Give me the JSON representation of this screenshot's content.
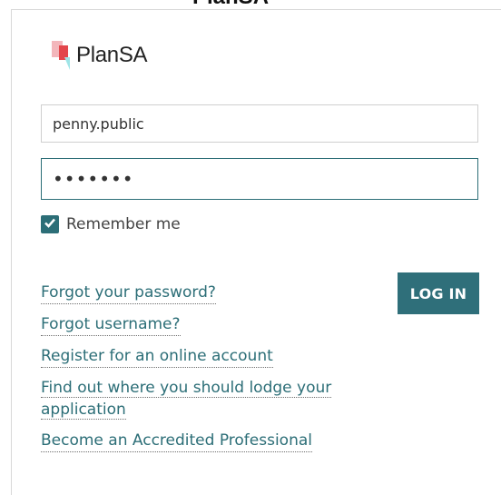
{
  "header": {
    "top_strip_text": "PlanSA"
  },
  "brand": {
    "logo_text": "PlanSA",
    "colors": {
      "red": "#e3464b",
      "pink": "#f3b6bb",
      "cyan": "#9fe5e7",
      "teal": "#2c6e77"
    }
  },
  "login": {
    "username_value": "penny.public",
    "password_value": "•••••••",
    "remember_label": "Remember me",
    "remember_checked": true,
    "login_button": "LOG IN"
  },
  "links": [
    "Forgot your password?",
    "Forgot username?",
    "Register for an online account",
    "Find out where you should lodge your application",
    "Become an Accredited Professional"
  ],
  "icons": {
    "checkbox": "check-icon",
    "logo": "plansa-logo-icon"
  }
}
